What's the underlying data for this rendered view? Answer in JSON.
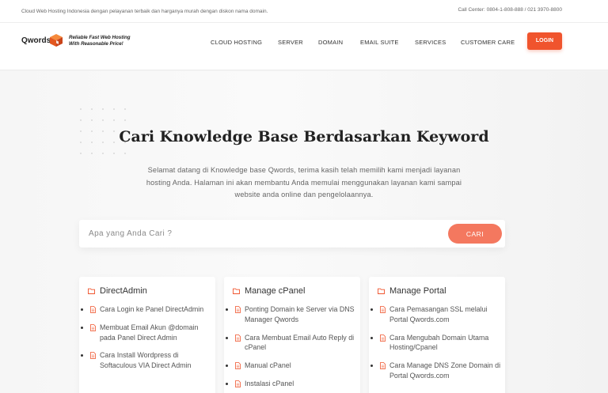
{
  "topbar": {
    "tagline": "Cloud Web Hosting Indonesia dengan pelayanan terbaik dan harganya murah dengan diskon nama domain.",
    "call_center": "Call Center: 0804-1-808-888 / 021 3970-8800"
  },
  "header": {
    "logo_word": "Qwords",
    "logo_slogan_line1": "Reliable Fast Web Hosting",
    "logo_slogan_line2": "With Reasonable Price!",
    "nav": [
      "CLOUD HOSTING",
      "SERVER",
      "DOMAIN",
      "EMAIL SUITE",
      "SERVICES",
      "CUSTOMER CARE"
    ],
    "login_label": "LOGIN"
  },
  "hero": {
    "title": "Cari Knowledge Base Berdasarkan Keyword",
    "description": "Selamat datang di Knowledge base Qwords, terima kasih telah memilih kami menjadi layanan hosting Anda. Halaman ini akan membantu Anda memulai menggunakan layanan kami sampai website anda online dan pengelolaannya."
  },
  "search": {
    "placeholder": "Apa yang Anda Cari ?",
    "button_label": "CARI"
  },
  "accent_color": "#f0542d",
  "cards": [
    {
      "title": "DirectAdmin",
      "items": [
        "Cara Login ke Panel DirectAdmin",
        "Membuat Email Akun @domain pada Panel Direct Admin",
        "Cara Install Wordpress di Softaculous VIA Direct Admin"
      ]
    },
    {
      "title": "Manage cPanel",
      "items": [
        "Ponting Domain ke Server via DNS Manager Qwords",
        "Cara Membuat Email Auto Reply di cPanel",
        "Manual cPanel",
        "Instalasi cPanel"
      ]
    },
    {
      "title": "Manage Portal",
      "items": [
        "Cara Pemasangan SSL melalui Portal Qwords.com",
        "Cara Mengubah Domain Utama Hosting/Cpanel",
        "Cara Manage DNS Zone Domain di Portal Qwords.com"
      ]
    }
  ]
}
